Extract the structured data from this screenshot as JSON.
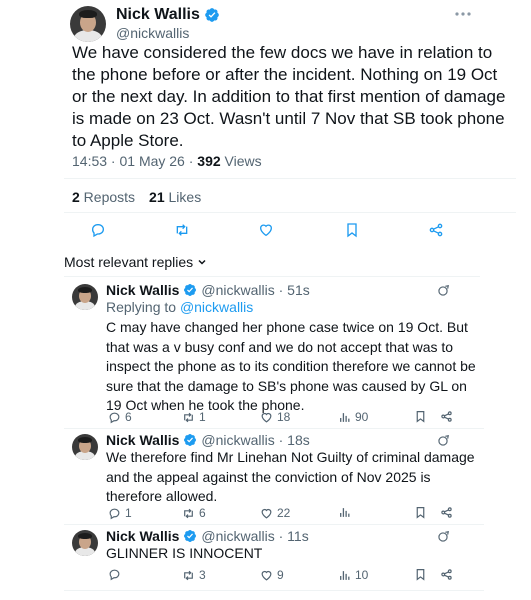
{
  "main_tweet": {
    "author_name": "Nick Wallis",
    "author_handle": "@nickwallis",
    "text": "We have considered the few docs we have in relation to the phone before or after the incident. Nothing on 19 Oct or the next day. In addition to that first mention of damage is made on 23 Oct. Wasn't until 7 Nov that SB took phone to Apple Store.",
    "time": "14:53 · 01 May 26 · ",
    "views_count": "392",
    "views_label": " Views",
    "reposts_count": "2",
    "reposts_label": " Reposts",
    "likes_count": "21",
    "likes_label": " Likes"
  },
  "sort_label": "Most relevant replies",
  "replies": [
    {
      "author_name": "Nick Wallis",
      "handle_time": "@nickwallis · 51s",
      "replying_prefix": "Replying to ",
      "replying_handle": "@nickwallis",
      "text": "C may have changed her phone case twice on 19 Oct. But that was a v busy conf and we do not accept that was to inspect the phone as to its condition therefore we cannot be sure that the damage to SB's phone was caused by GL on 19 Oct when he took the phone.",
      "replies": "6",
      "reposts": "1",
      "likes": "18",
      "views": "90"
    },
    {
      "author_name": "Nick Wallis",
      "handle_time": "@nickwallis · 18s",
      "text": "We therefore find Mr Linehan Not Guilty of criminal damage and the appeal against the conviction of Nov 2025 is therefore allowed.",
      "replies": "1",
      "reposts": "6",
      "likes": "22",
      "views": ""
    },
    {
      "author_name": "Nick Wallis",
      "handle_time": "@nickwallis · 11s",
      "text": "GLINNER IS INNOCENT",
      "replies": "",
      "reposts": "3",
      "likes": "9",
      "views": "10"
    }
  ],
  "colors": {
    "verified": "#1d9bf0",
    "text": "#0f1419",
    "secondary": "#536471",
    "link": "#1d9bf0"
  }
}
